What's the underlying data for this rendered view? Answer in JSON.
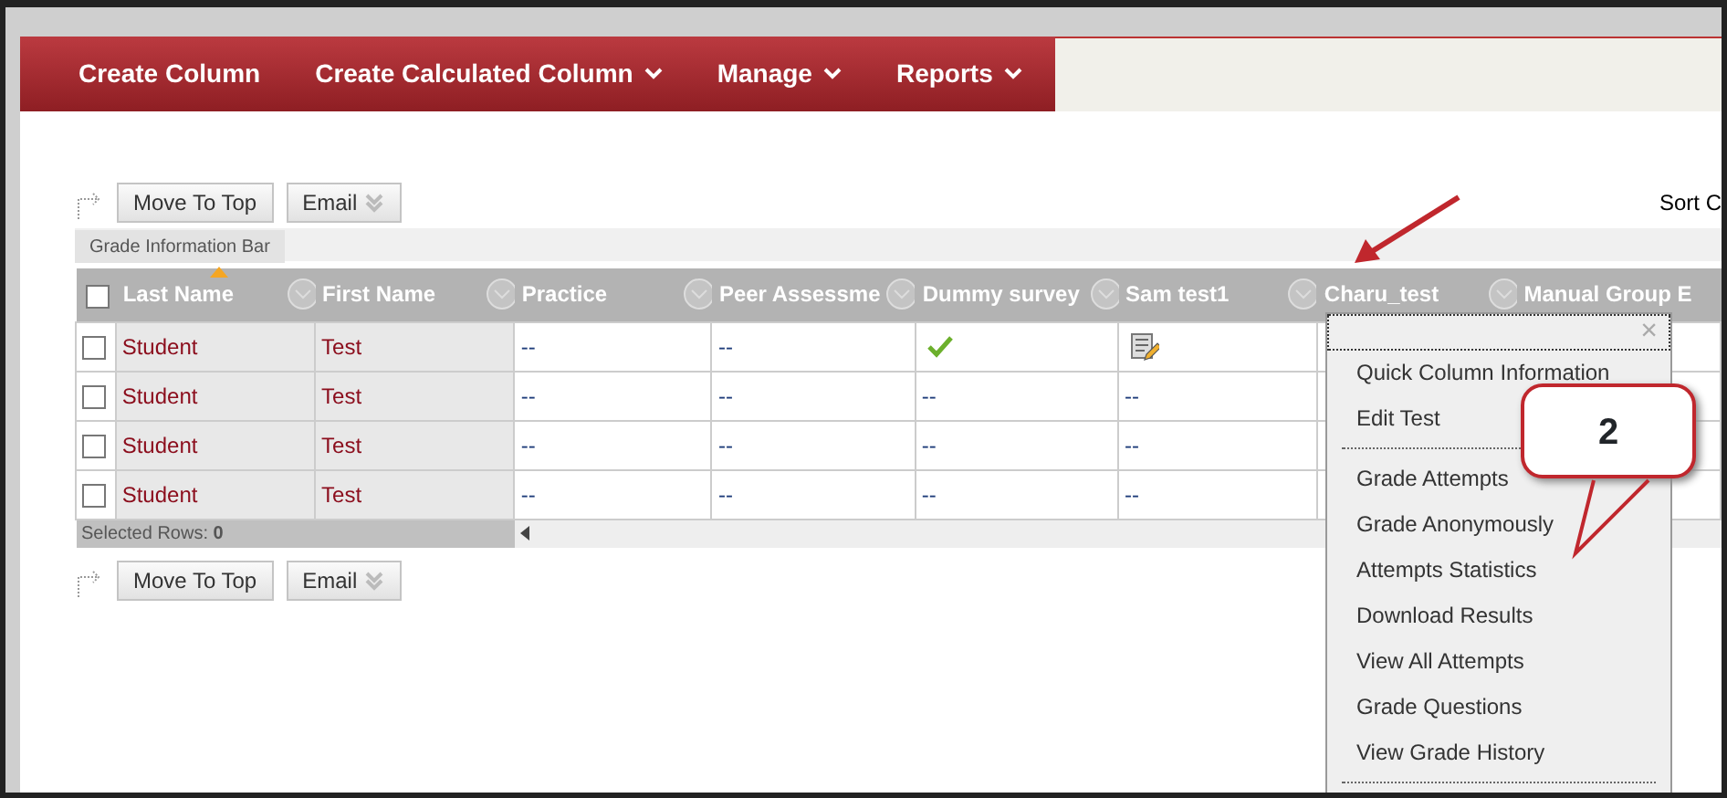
{
  "nav": {
    "items": [
      {
        "label": "Create Column",
        "has_menu": false
      },
      {
        "label": "Create Calculated Column",
        "has_menu": true
      },
      {
        "label": "Manage",
        "has_menu": true
      },
      {
        "label": "Reports",
        "has_menu": true
      }
    ]
  },
  "toolbar_top": {
    "buttons": [
      {
        "label": "Move To Top",
        "kind": "plain"
      },
      {
        "label": "Email",
        "kind": "menu"
      }
    ],
    "sort_label": "Sort C"
  },
  "info_bar": {
    "label": "Grade Information Bar"
  },
  "table": {
    "columns": [
      {
        "kind": "checkbox",
        "checked": false
      },
      {
        "kind": "label",
        "label": "Last Name",
        "sorted": true
      },
      {
        "kind": "label",
        "label": "First Name",
        "sorted": false
      },
      {
        "kind": "label",
        "label": "Practice",
        "sorted": false
      },
      {
        "kind": "label",
        "label": "Peer Assessme",
        "sorted": false
      },
      {
        "kind": "label",
        "label": "Dummy survey",
        "sorted": false
      },
      {
        "kind": "label",
        "label": "Sam test1",
        "sorted": false
      },
      {
        "kind": "label",
        "label": "Charu_test",
        "sorted": false
      },
      {
        "kind": "label",
        "label": "Manual Group E",
        "sorted": false
      }
    ],
    "rows": [
      {
        "cells": [
          {
            "kind": "checkbox",
            "checked": false
          },
          {
            "kind": "name",
            "text": "Student"
          },
          {
            "kind": "name",
            "text": "Test"
          },
          {
            "kind": "text",
            "text": "--"
          },
          {
            "kind": "text",
            "text": "--"
          },
          {
            "kind": "check"
          },
          {
            "kind": "edit"
          }
        ]
      },
      {
        "cells": [
          {
            "kind": "checkbox",
            "checked": false
          },
          {
            "kind": "name",
            "text": "Student"
          },
          {
            "kind": "name",
            "text": "Test"
          },
          {
            "kind": "text",
            "text": "--"
          },
          {
            "kind": "text",
            "text": "--"
          },
          {
            "kind": "text",
            "text": "--"
          },
          {
            "kind": "text",
            "text": "--"
          }
        ]
      },
      {
        "cells": [
          {
            "kind": "checkbox",
            "checked": false
          },
          {
            "kind": "name",
            "text": "Student"
          },
          {
            "kind": "name",
            "text": "Test"
          },
          {
            "kind": "text",
            "text": "--"
          },
          {
            "kind": "text",
            "text": "--"
          },
          {
            "kind": "text",
            "text": "--"
          },
          {
            "kind": "text",
            "text": "--"
          }
        ]
      },
      {
        "cells": [
          {
            "kind": "checkbox",
            "checked": false
          },
          {
            "kind": "name",
            "text": "Student"
          },
          {
            "kind": "name",
            "text": "Test"
          },
          {
            "kind": "text",
            "text": "--"
          },
          {
            "kind": "text",
            "text": "--"
          },
          {
            "kind": "text",
            "text": "--"
          },
          {
            "kind": "text",
            "text": "--"
          }
        ]
      }
    ],
    "selected_rows": {
      "label": "Selected Rows:",
      "count": "0"
    }
  },
  "toolbar_bottom": {
    "buttons": [
      {
        "label": "Move To Top",
        "kind": "plain"
      },
      {
        "label": "Email",
        "kind": "menu"
      }
    ]
  },
  "context_menu": {
    "close": "×",
    "items": [
      {
        "kind": "item",
        "label": "Quick Column Information"
      },
      {
        "kind": "item",
        "label": "Edit Test"
      },
      {
        "kind": "divider"
      },
      {
        "kind": "item",
        "label": "Grade Attempts"
      },
      {
        "kind": "item",
        "label": "Grade Anonymously"
      },
      {
        "kind": "item",
        "label": "Attempts Statistics"
      },
      {
        "kind": "item",
        "label": "Download Results"
      },
      {
        "kind": "item",
        "label": "View All Attempts"
      },
      {
        "kind": "item",
        "label": "Grade Questions"
      },
      {
        "kind": "item",
        "label": "View Grade History"
      },
      {
        "kind": "divider"
      }
    ]
  },
  "callout": {
    "text": "2"
  }
}
